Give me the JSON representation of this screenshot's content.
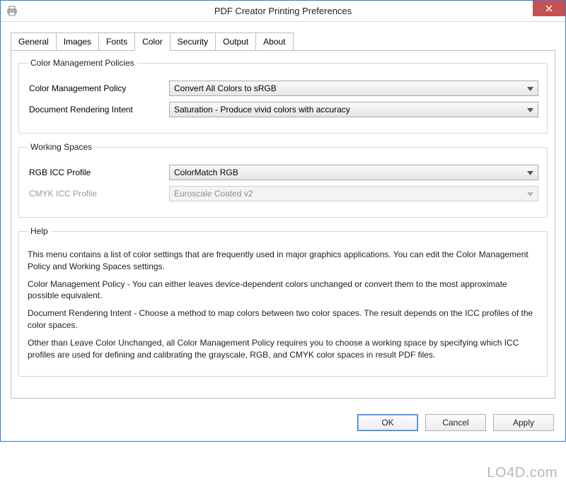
{
  "window": {
    "title": "PDF Creator Printing Preferences"
  },
  "tabs": [
    "General",
    "Images",
    "Fonts",
    "Color",
    "Security",
    "Output",
    "About"
  ],
  "active_tab_index": 3,
  "group_cmp": {
    "legend": "Color Management Policies",
    "policy_label": "Color Management Policy",
    "policy_value": "Convert All Colors to sRGB",
    "intent_label": "Document Rendering Intent",
    "intent_value": "Saturation - Produce vivid colors with accuracy"
  },
  "group_ws": {
    "legend": "Working Spaces",
    "rgb_label": "RGB ICC Profile",
    "rgb_value": "ColorMatch RGB",
    "cmyk_label": "CMYK ICC Profile",
    "cmyk_value": "Euroscale Coated v2"
  },
  "group_help": {
    "legend": "Help",
    "p1": "This menu contains a list of color settings that are frequently used in major graphics applications. You can edit the Color Management Policy and Working Spaces settings.",
    "p2": "Color Management Policy - You can either leaves device-dependent colors unchanged or convert them to the most approximate possible equivalent.",
    "p3": "Document Rendering Intent - Choose a method to map colors between two color spaces. The result depends on the ICC profiles of the color spaces.",
    "p4": "Other than Leave Color Unchanged, all Color Management Policy requires you to choose a working space by specifying which ICC profiles are used for defining and calibrating the grayscale, RGB, and CMYK color spaces in result PDF files."
  },
  "buttons": {
    "ok": "OK",
    "cancel": "Cancel",
    "apply": "Apply"
  },
  "watermark": "LO4D.com"
}
